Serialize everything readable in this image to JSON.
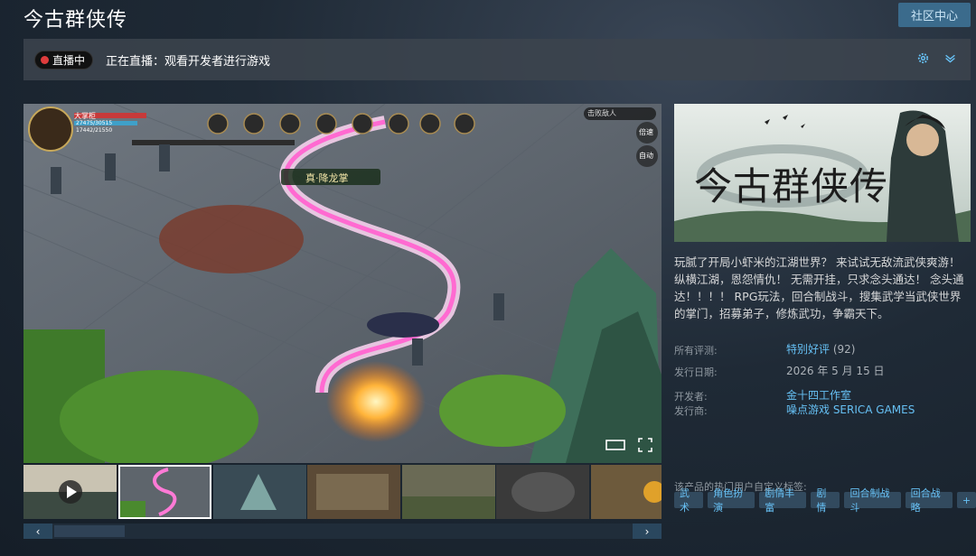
{
  "game": {
    "title": "今古群侠传",
    "community_button": "社区中心"
  },
  "live": {
    "badge": "直播中",
    "text": "正在直播：观看开发者进行游戏",
    "settings_icon": "gear-icon",
    "expand_icon": "chevron-down-icon"
  },
  "screenshot": {
    "hud_hp": "27475/30515",
    "hud_mp": "17442/21550",
    "hud_name": "大掌柜",
    "skill_label": "真·降龙掌",
    "top_right_label": "击败敌人",
    "btn_speed": "倍速",
    "btn_auto": "自动"
  },
  "capsule": {
    "logo_text": "今古群侠传"
  },
  "description": "玩腻了开局小虾米的江湖世界？ 来试试无敌流武侠爽游！ 纵横江湖，恩怨情仇！ 无需开挂，只求念头通达！ 念头通达！！！！ RPG玩法，回合制战斗，搜集武学当武侠世界的掌门，招募弟子，修炼武功，争霸天下。",
  "meta": {
    "reviews_label": "所有评测:",
    "reviews_value": "特别好评",
    "reviews_count": "(92)",
    "release_label": "发行日期:",
    "release_value": "2026 年 5 月 15 日",
    "developer_label": "开发者:",
    "developer_value": "金十四工作室",
    "publisher_label": "发行商:",
    "publisher_value": "噪点游戏 SERICA GAMES"
  },
  "tags": {
    "label": "该产品的热门用户自定义标签:",
    "items": [
      "武术",
      "角色扮演",
      "剧情丰富",
      "剧情",
      "回合制战斗",
      "回合战略",
      "+"
    ]
  },
  "nav": {
    "prev": "‹",
    "next": "›"
  },
  "colors": {
    "accent_link": "#66c0f4",
    "tag_bg": "#324a5e",
    "button_bg": "#3b6b8c"
  }
}
